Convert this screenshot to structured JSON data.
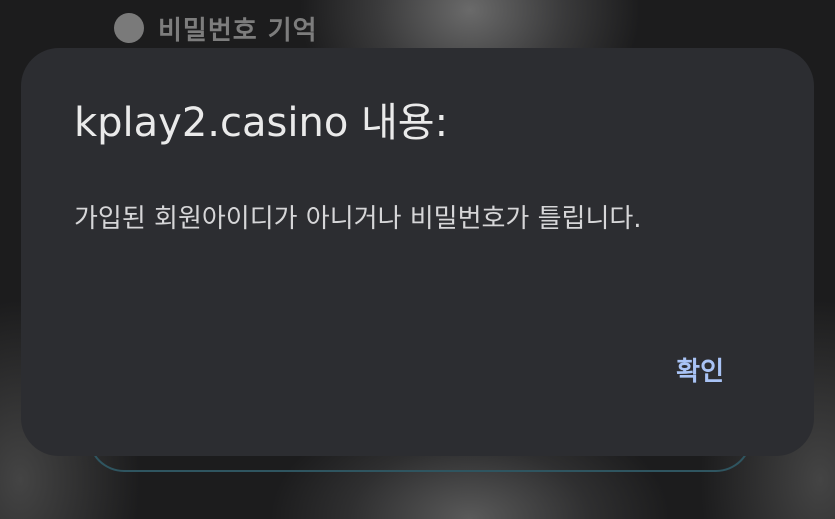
{
  "background": {
    "remember_password_label": "비밀번호 기억"
  },
  "dialog": {
    "title": "kplay2.casino 내용:",
    "message": "가입된 회원아이디가 아니거나 비밀번호가 틀립니다.",
    "confirm_label": "확인"
  },
  "colors": {
    "dialog_bg": "#2c2d31",
    "accent": "#a9c3f5"
  }
}
